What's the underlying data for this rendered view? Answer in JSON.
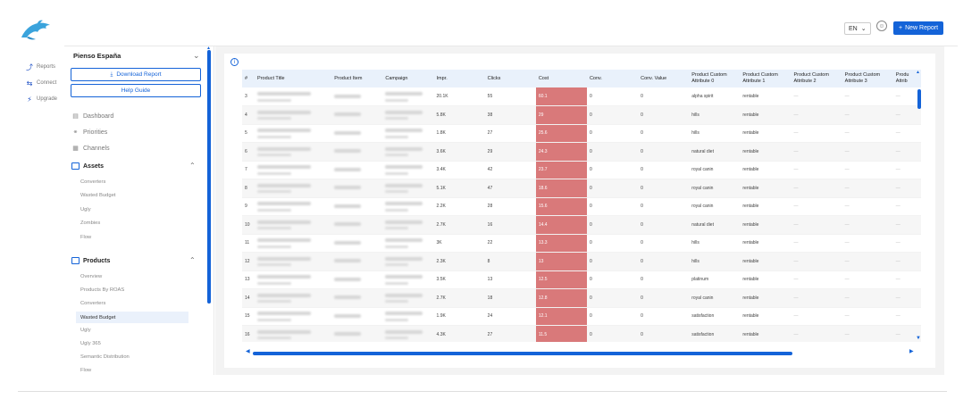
{
  "rail": {
    "items": [
      {
        "label": "Reports",
        "icon": "reports-icon"
      },
      {
        "label": "Connect",
        "icon": "connect-icon"
      },
      {
        "label": "Upgrade",
        "icon": "upgrade-icon"
      }
    ]
  },
  "topbar": {
    "language": "EN",
    "new_report_label": "New Report",
    "accent": "#1463d8"
  },
  "sidebar": {
    "account_name": "Pienso España",
    "download_label": "Download Report",
    "help_label": "Help Guide",
    "nav": [
      {
        "label": "Dashboard",
        "icon": "dashboard-icon"
      },
      {
        "label": "Priorities",
        "icon": "priorities-icon"
      },
      {
        "label": "Channels",
        "icon": "channels-icon"
      }
    ],
    "assets": {
      "label": "Assets",
      "items": [
        "Converters",
        "Wasted Budget",
        "Ugly",
        "Zombies",
        "Flow"
      ]
    },
    "products": {
      "label": "Products",
      "items": [
        "Overview",
        "Products By ROAS",
        "Converters",
        "Wasted Budget",
        "Ugly",
        "Ugly 365",
        "Semantic Distribution",
        "Flow"
      ],
      "active_index": 3
    }
  },
  "table": {
    "columns": [
      "#",
      "Product Title",
      "Product Item",
      "Campaign",
      "Impr.",
      "Clicks",
      "Cost",
      "Conv.",
      "Conv. Value",
      "Product Custom Attribute 0",
      "Product Custom Attribute 1",
      "Product Custom Attribute 2",
      "Product Custom Attribute 3",
      "Product Custom Attribute 4"
    ],
    "truncated_last_column": "Produ Attrib",
    "rows": [
      {
        "n": "3",
        "impr": "20.1K",
        "clicks": "55",
        "cost": "60.1",
        "conv": "0",
        "conv_value": "0",
        "attr0": "alpha spirit",
        "attr1": "rentable",
        "attr2": "—",
        "attr3": "—",
        "attr4": "—"
      },
      {
        "n": "4",
        "impr": "5.8K",
        "clicks": "38",
        "cost": "29",
        "conv": "0",
        "conv_value": "0",
        "attr0": "hills",
        "attr1": "rentable",
        "attr2": "—",
        "attr3": "—",
        "attr4": "—"
      },
      {
        "n": "5",
        "impr": "1.8K",
        "clicks": "27",
        "cost": "25.6",
        "conv": "0",
        "conv_value": "0",
        "attr0": "hills",
        "attr1": "rentable",
        "attr2": "—",
        "attr3": "—",
        "attr4": "—"
      },
      {
        "n": "6",
        "impr": "3.6K",
        "clicks": "29",
        "cost": "24.3",
        "conv": "0",
        "conv_value": "0",
        "attr0": "natural diet",
        "attr1": "rentable",
        "attr2": "—",
        "attr3": "—",
        "attr4": "—"
      },
      {
        "n": "7",
        "impr": "3.4K",
        "clicks": "42",
        "cost": "23.7",
        "conv": "0",
        "conv_value": "0",
        "attr0": "royal canin",
        "attr1": "rentable",
        "attr2": "—",
        "attr3": "—",
        "attr4": "—"
      },
      {
        "n": "8",
        "impr": "5.1K",
        "clicks": "47",
        "cost": "18.6",
        "conv": "0",
        "conv_value": "0",
        "attr0": "royal canin",
        "attr1": "rentable",
        "attr2": "—",
        "attr3": "—",
        "attr4": "—"
      },
      {
        "n": "9",
        "impr": "2.2K",
        "clicks": "28",
        "cost": "15.6",
        "conv": "0",
        "conv_value": "0",
        "attr0": "royal canin",
        "attr1": "rentable",
        "attr2": "—",
        "attr3": "—",
        "attr4": "—"
      },
      {
        "n": "10",
        "impr": "2.7K",
        "clicks": "16",
        "cost": "14.4",
        "conv": "0",
        "conv_value": "0",
        "attr0": "natural diet",
        "attr1": "rentable",
        "attr2": "—",
        "attr3": "—",
        "attr4": "—"
      },
      {
        "n": "11",
        "impr": "3K",
        "clicks": "22",
        "cost": "13.3",
        "conv": "0",
        "conv_value": "0",
        "attr0": "hills",
        "attr1": "rentable",
        "attr2": "—",
        "attr3": "—",
        "attr4": "—"
      },
      {
        "n": "12",
        "impr": "2.3K",
        "clicks": "8",
        "cost": "13",
        "conv": "0",
        "conv_value": "0",
        "attr0": "hills",
        "attr1": "rentable",
        "attr2": "—",
        "attr3": "—",
        "attr4": "—"
      },
      {
        "n": "13",
        "impr": "3.5K",
        "clicks": "13",
        "cost": "12.5",
        "conv": "0",
        "conv_value": "0",
        "attr0": "platinum",
        "attr1": "rentable",
        "attr2": "—",
        "attr3": "—",
        "attr4": "—"
      },
      {
        "n": "14",
        "impr": "2.7K",
        "clicks": "18",
        "cost": "12.8",
        "conv": "0",
        "conv_value": "0",
        "attr0": "royal canin",
        "attr1": "rentable",
        "attr2": "—",
        "attr3": "—",
        "attr4": "—"
      },
      {
        "n": "15",
        "impr": "1.9K",
        "clicks": "24",
        "cost": "12.1",
        "conv": "0",
        "conv_value": "0",
        "attr0": "satisfaction",
        "attr1": "rentable",
        "attr2": "—",
        "attr3": "—",
        "attr4": "—"
      },
      {
        "n": "16",
        "impr": "4.3K",
        "clicks": "27",
        "cost": "11.5",
        "conv": "0",
        "conv_value": "0",
        "attr0": "satisfaction",
        "attr1": "rentable",
        "attr2": "—",
        "attr3": "—",
        "attr4": "—"
      }
    ],
    "cost_highlight_color": "#d9797a"
  }
}
